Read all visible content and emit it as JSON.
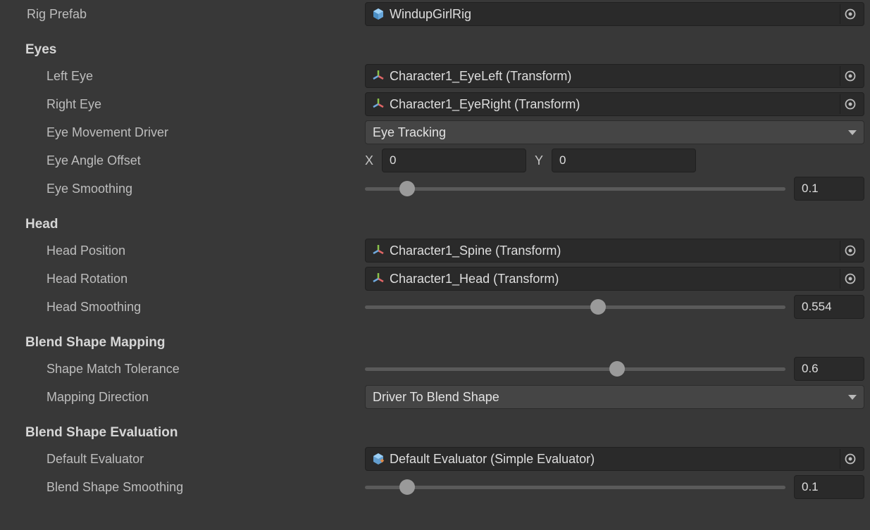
{
  "rigPrefab": {
    "label": "Rig Prefab",
    "value": "WindupGirlRig"
  },
  "sections": {
    "eyes": {
      "title": "Eyes",
      "leftEye": {
        "label": "Left Eye",
        "value": "Character1_EyeLeft (Transform)"
      },
      "rightEye": {
        "label": "Right Eye",
        "value": "Character1_EyeRight (Transform)"
      },
      "driver": {
        "label": "Eye Movement Driver",
        "value": "Eye Tracking"
      },
      "angleOffset": {
        "label": "Eye Angle Offset",
        "x": "0",
        "y": "0"
      },
      "smoothing": {
        "label": "Eye Smoothing",
        "value": "0.1",
        "percent": 10
      }
    },
    "head": {
      "title": "Head",
      "position": {
        "label": "Head Position",
        "value": "Character1_Spine (Transform)"
      },
      "rotation": {
        "label": "Head Rotation",
        "value": "Character1_Head (Transform)"
      },
      "smoothing": {
        "label": "Head Smoothing",
        "value": "0.554",
        "percent": 55.4
      }
    },
    "blendMap": {
      "title": "Blend Shape Mapping",
      "tolerance": {
        "label": "Shape Match Tolerance",
        "value": "0.6",
        "percent": 60
      },
      "direction": {
        "label": "Mapping Direction",
        "value": "Driver To Blend Shape"
      }
    },
    "blendEval": {
      "title": "Blend Shape Evaluation",
      "evaluator": {
        "label": "Default Evaluator",
        "value": "Default Evaluator (Simple Evaluator)"
      },
      "smoothing": {
        "label": "Blend Shape Smoothing",
        "value": "0.1",
        "percent": 10
      }
    }
  },
  "icons": {
    "prefab": "prefab-cube",
    "transform": "transform-gizmo",
    "scriptable": "scriptable-cube"
  }
}
